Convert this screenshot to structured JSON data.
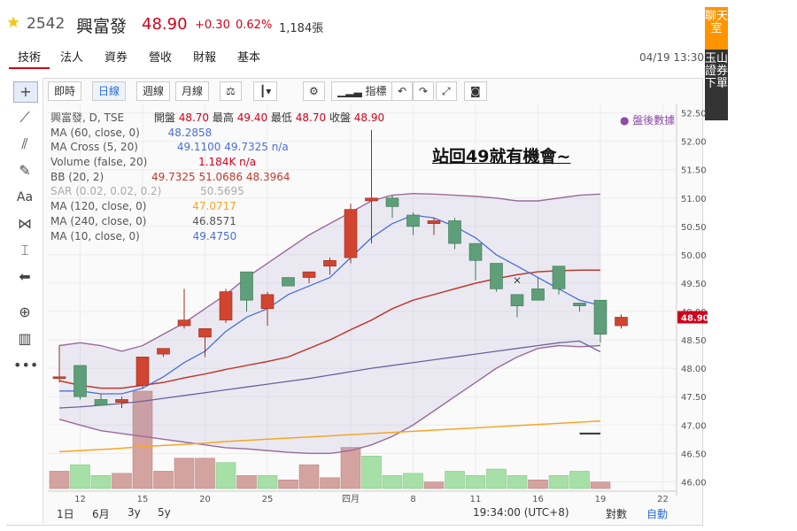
{
  "header": {
    "code": "2542",
    "name": "興富發",
    "price": "48.90",
    "change": "+0.30",
    "change_pct": "0.62%",
    "volume": "1,184張"
  },
  "tabs": [
    "技術",
    "法人",
    "資券",
    "營收",
    "財報",
    "基本"
  ],
  "datetime": "04/19 13:30",
  "side_panel": {
    "chat": "聊天室",
    "app": "玉山證券下單"
  },
  "toolbar": {
    "intraday": "即時",
    "daily": "日線",
    "weekly": "週線",
    "monthly": "月線",
    "indicators": "指標"
  },
  "legend": {
    "main": "興富發, D, TSE",
    "open_label": "開盤",
    "open": "48.70",
    "high_label": "最高",
    "high": "49.40",
    "low_label": "最低",
    "low": "48.70",
    "close_label": "收盤",
    "close": "48.90",
    "items": [
      {
        "name": "MA (60, close, 0)",
        "values": "48.2858",
        "color": "#4a6fd6"
      },
      {
        "name": "MA Cross (5, 20)",
        "values": "49.1100  49.7325  n/a",
        "color": "#4a6fd6"
      },
      {
        "name": "Volume (false, 20)",
        "values": "1.184K  n/a",
        "color": "#d0021b"
      },
      {
        "name": "BB (20, 2)",
        "values": "49.7325  51.0686  48.3964",
        "color": "#c0392b"
      },
      {
        "name": "SAR (0.02, 0.02, 0.2)",
        "values": "50.5695",
        "color": "#aaaaaa"
      },
      {
        "name": "MA (120, close, 0)",
        "values": "47.0717",
        "color": "#f5a623"
      },
      {
        "name": "MA (240, close, 0)",
        "values": "46.8571",
        "color": "#555555"
      },
      {
        "name": "MA (10, close, 0)",
        "values": "49.4750",
        "color": "#4a6fd6"
      }
    ]
  },
  "annotation": "站回49就有機會~",
  "after_hours": "● 盤後數據",
  "bottom": {
    "ranges": [
      "1日",
      "6月",
      "3y",
      "5y"
    ],
    "time": "19:34:00 (UTC+8)",
    "log": "對數",
    "auto": "自動"
  },
  "colors": {
    "up": "#d04430",
    "down": "#5e9e78",
    "price_red": "#d0021b",
    "accent": "#2a6cd6"
  },
  "chart_data": {
    "type": "candlestick",
    "y_ticks": [
      46.0,
      46.5,
      47.0,
      47.5,
      48.0,
      48.5,
      49.0,
      49.5,
      50.0,
      50.5,
      51.0,
      51.5,
      52.0,
      52.5
    ],
    "ylim": [
      45.85,
      52.65
    ],
    "last_price_label": "48.90",
    "x_tick_labels": [
      {
        "label": "12",
        "index": 1
      },
      {
        "label": "15",
        "index": 4
      },
      {
        "label": "20",
        "index": 7
      },
      {
        "label": "25",
        "index": 10
      },
      {
        "label": "四月",
        "index": 14
      },
      {
        "label": "8",
        "index": 17
      },
      {
        "label": "11",
        "index": 20
      },
      {
        "label": "16",
        "index": 23
      },
      {
        "label": "19",
        "index": 26
      },
      {
        "label": "22",
        "index": 29
      }
    ],
    "n_slots": 30,
    "candles": [
      {
        "o": 47.85,
        "h": 48.4,
        "l": 47.75,
        "c": 47.85
      },
      {
        "o": 48.05,
        "h": 48.05,
        "l": 47.45,
        "c": 47.5
      },
      {
        "o": 47.45,
        "h": 47.55,
        "l": 47.35,
        "c": 47.35
      },
      {
        "o": 47.4,
        "h": 47.5,
        "l": 47.3,
        "c": 47.45
      },
      {
        "o": 47.7,
        "h": 48.2,
        "l": 47.65,
        "c": 48.2
      },
      {
        "o": 48.25,
        "h": 48.35,
        "l": 48.2,
        "c": 48.35
      },
      {
        "o": 48.75,
        "h": 49.4,
        "l": 48.7,
        "c": 48.85
      },
      {
        "o": 48.55,
        "h": 48.7,
        "l": 48.2,
        "c": 48.7
      },
      {
        "o": 48.85,
        "h": 49.4,
        "l": 48.8,
        "c": 49.35
      },
      {
        "o": 49.7,
        "h": 49.7,
        "l": 49.0,
        "c": 49.2
      },
      {
        "o": 49.05,
        "h": 49.35,
        "l": 48.75,
        "c": 49.3
      },
      {
        "o": 49.6,
        "h": 49.6,
        "l": 49.45,
        "c": 49.45
      },
      {
        "o": 49.6,
        "h": 49.7,
        "l": 49.5,
        "c": 49.7
      },
      {
        "o": 49.8,
        "h": 49.95,
        "l": 49.65,
        "c": 49.9
      },
      {
        "o": 49.95,
        "h": 50.9,
        "l": 49.85,
        "c": 50.8
      },
      {
        "o": 50.95,
        "h": 52.2,
        "l": 50.2,
        "c": 51.0
      },
      {
        "o": 51.0,
        "h": 51.05,
        "l": 50.65,
        "c": 50.85
      },
      {
        "o": 50.7,
        "h": 50.75,
        "l": 50.35,
        "c": 50.5
      },
      {
        "o": 50.55,
        "h": 50.65,
        "l": 50.35,
        "c": 50.6
      },
      {
        "o": 50.6,
        "h": 50.65,
        "l": 50.1,
        "c": 50.2
      },
      {
        "o": 50.2,
        "h": 50.2,
        "l": 49.55,
        "c": 49.9
      },
      {
        "o": 49.85,
        "h": 49.85,
        "l": 49.35,
        "c": 49.4
      },
      {
        "o": 49.3,
        "h": 49.3,
        "l": 48.9,
        "c": 49.1
      },
      {
        "o": 49.4,
        "h": 49.6,
        "l": 49.2,
        "c": 49.2
      },
      {
        "o": 49.8,
        "h": 49.8,
        "l": 49.3,
        "c": 49.4
      },
      {
        "o": 49.15,
        "h": 49.15,
        "l": 49.0,
        "c": 49.1
      },
      {
        "o": 49.2,
        "h": 49.2,
        "l": 48.45,
        "c": 48.6
      },
      {
        "o": 48.75,
        "h": 48.95,
        "l": 48.7,
        "c": 48.9
      }
    ],
    "volumes": [
      {
        "v": 0.8,
        "up": true
      },
      {
        "v": 1.1,
        "up": false
      },
      {
        "v": 0.6,
        "up": false
      },
      {
        "v": 0.7,
        "up": true
      },
      {
        "v": 4.5,
        "up": true
      },
      {
        "v": 0.8,
        "up": true
      },
      {
        "v": 1.4,
        "up": true
      },
      {
        "v": 1.4,
        "up": true
      },
      {
        "v": 1.2,
        "up": false
      },
      {
        "v": 0.6,
        "up": true
      },
      {
        "v": 0.6,
        "up": false
      },
      {
        "v": 0.4,
        "up": true
      },
      {
        "v": 1.1,
        "up": true
      },
      {
        "v": 0.5,
        "up": true
      },
      {
        "v": 1.9,
        "up": true
      },
      {
        "v": 1.5,
        "up": false
      },
      {
        "v": 0.6,
        "up": false
      },
      {
        "v": 0.7,
        "up": false
      },
      {
        "v": 0.3,
        "up": true
      },
      {
        "v": 0.8,
        "up": false
      },
      {
        "v": 0.6,
        "up": false
      },
      {
        "v": 0.9,
        "up": false
      },
      {
        "v": 0.6,
        "up": false
      },
      {
        "v": 0.4,
        "up": true
      },
      {
        "v": 0.6,
        "up": false
      },
      {
        "v": 0.8,
        "up": false
      },
      {
        "v": 0.3,
        "up": true
      }
    ],
    "volume_scale_max": 4.5,
    "ma5": [
      47.6,
      47.6,
      47.55,
      47.55,
      47.65,
      47.85,
      48.1,
      48.3,
      48.65,
      48.9,
      49.05,
      49.3,
      49.45,
      49.6,
      49.95,
      50.3,
      50.55,
      50.7,
      50.65,
      50.5,
      50.3,
      50.0,
      49.8,
      49.6,
      49.4,
      49.2,
      49.11
    ],
    "ma20": [
      47.78,
      47.7,
      47.65,
      47.65,
      47.7,
      47.75,
      47.83,
      47.9,
      47.98,
      48.05,
      48.12,
      48.2,
      48.35,
      48.5,
      48.68,
      48.85,
      49.05,
      49.2,
      49.3,
      49.4,
      49.5,
      49.58,
      49.65,
      49.7,
      49.72,
      49.73,
      49.73
    ],
    "ma60": [
      47.3,
      47.32,
      47.35,
      47.38,
      47.42,
      47.47,
      47.52,
      47.57,
      47.62,
      47.67,
      47.72,
      47.77,
      47.82,
      47.88,
      47.94,
      48.0,
      48.05,
      48.1,
      48.15,
      48.2,
      48.25,
      48.3,
      48.35,
      48.4,
      48.45,
      48.48,
      48.29
    ],
    "ma120": [
      46.53,
      46.55,
      46.57,
      46.59,
      46.62,
      46.64,
      46.66,
      46.68,
      46.71,
      46.73,
      46.75,
      46.77,
      46.79,
      46.81,
      46.83,
      46.85,
      46.87,
      46.89,
      46.91,
      46.93,
      46.95,
      46.97,
      46.99,
      47.01,
      47.03,
      47.05,
      47.07
    ],
    "ma240_segment": {
      "from_index": 25,
      "to_index": 26,
      "value": 46.85
    },
    "bb_upper": [
      48.4,
      48.45,
      48.4,
      48.3,
      48.4,
      48.6,
      48.8,
      49.05,
      49.3,
      49.6,
      49.85,
      50.1,
      50.35,
      50.55,
      50.75,
      50.95,
      51.05,
      51.08,
      51.07,
      51.05,
      51.03,
      51.0,
      50.95,
      50.95,
      51.0,
      51.05,
      51.07
    ],
    "bb_lower": [
      47.1,
      47.0,
      46.9,
      46.85,
      46.8,
      46.75,
      46.7,
      46.65,
      46.6,
      46.58,
      46.55,
      46.52,
      46.5,
      46.5,
      46.55,
      46.65,
      46.8,
      47.0,
      47.25,
      47.5,
      47.75,
      48.0,
      48.2,
      48.35,
      48.4,
      48.38,
      48.4
    ],
    "macross_point": {
      "index": 22,
      "value": 49.55
    }
  }
}
